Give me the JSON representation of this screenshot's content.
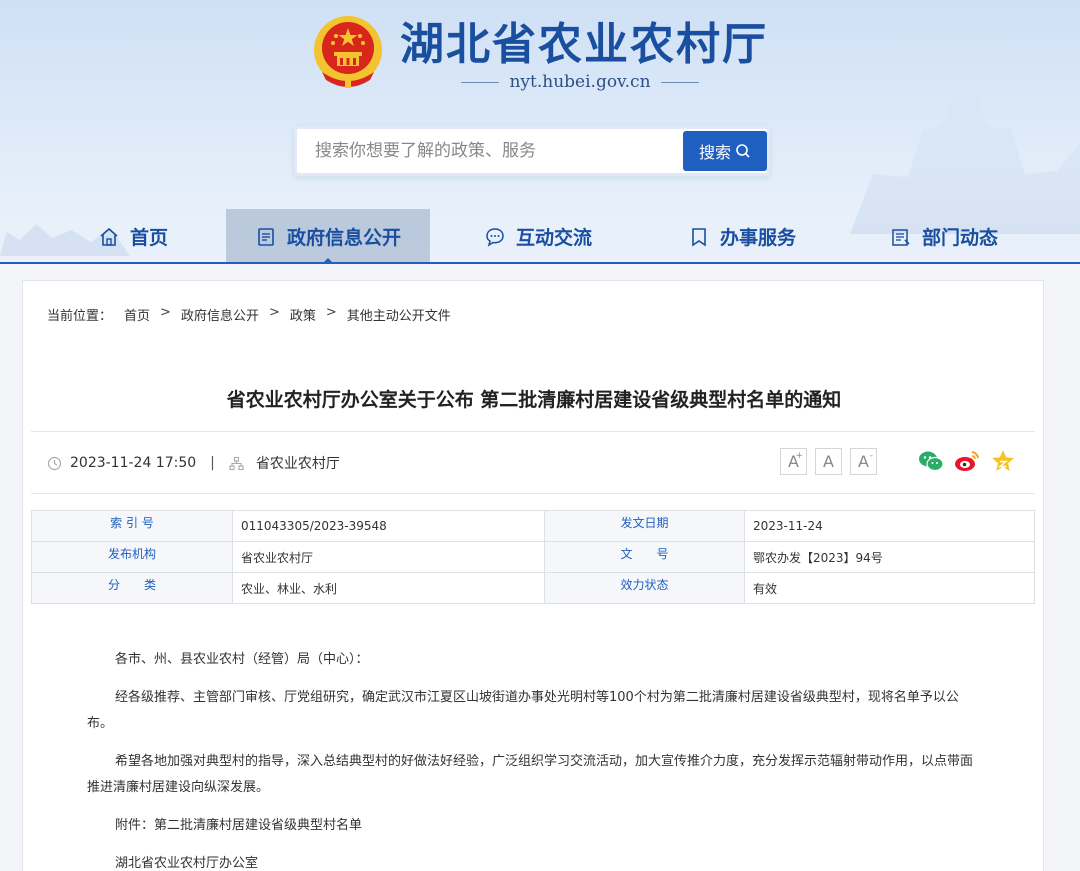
{
  "header": {
    "site_title": "湖北省农业农村厅",
    "site_url": "nyt.hubei.gov.cn",
    "search": {
      "placeholder": "搜索你想要了解的政策、服务",
      "button_label": "搜索"
    }
  },
  "nav": [
    {
      "label": "首页",
      "icon": "home-icon",
      "active": false
    },
    {
      "label": "政府信息公开",
      "icon": "document-icon",
      "active": true
    },
    {
      "label": "互动交流",
      "icon": "chat-icon",
      "active": false
    },
    {
      "label": "办事服务",
      "icon": "bookmark-icon",
      "active": false
    },
    {
      "label": "部门动态",
      "icon": "news-icon",
      "active": false
    }
  ],
  "breadcrumb": {
    "prefix": "当前位置：",
    "items": [
      "首页",
      "政府信息公开",
      "政策",
      "其他主动公开文件"
    ],
    "separator": ">"
  },
  "article": {
    "title": "省农业农村厅办公室关于公布 第二批清廉村居建设省级典型村名单的通知",
    "datetime": "2023-11-24 17:50",
    "divider": "|",
    "source": "省农业农村厅",
    "font_buttons": [
      "A",
      "A",
      "A"
    ],
    "share": [
      "wechat-icon",
      "weibo-icon",
      "star-icon"
    ]
  },
  "info": {
    "rows": [
      {
        "k1": "索 引 号",
        "v1": "011043305/2023-39548",
        "k2": "发文日期",
        "v2": "2023-11-24"
      },
      {
        "k1": "发布机构",
        "v1": "省农业农村厅",
        "k2": "文　　号",
        "v2": "鄂农办发【2023】94号"
      },
      {
        "k1": "分　　类",
        "v1": "农业、林业、水利",
        "k2": "效力状态",
        "v2": "有效"
      }
    ]
  },
  "body": {
    "p1": "各市、州、县农业农村（经管）局（中心）：",
    "p2": "经各级推荐、主管部门审核、厅党组研究，确定武汉市江夏区山坡街道办事处光明村等100个村为第二批清廉村居建设省级典型村，现将名单予以公布。",
    "p3": "希望各地加强对典型村的指导，深入总结典型村的好做法好经验，广泛组织学习交流活动，加大宣传推介力度，充分发挥示范辐射带动作用，以点带面推进清廉村居建设向纵深发展。",
    "p4": "附件：第二批清廉村居建设省级典型村名单",
    "p5": "湖北省农业农村厅办公室"
  },
  "colors": {
    "brand_blue": "#1f5fbf",
    "title_blue": "#1a4fa0",
    "emblem_red": "#d8261c",
    "emblem_gold": "#f4c430"
  }
}
